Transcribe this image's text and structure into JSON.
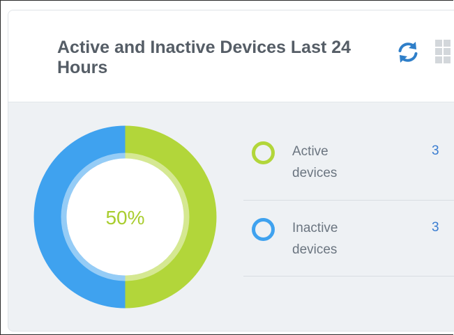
{
  "widget": {
    "title": "Active and Inactive Devices Last 24 Hours",
    "refresh_icon": "refresh-icon",
    "drag_handle_icon": "grid-handle-icon"
  },
  "chart_data": {
    "type": "pie",
    "categories": [
      "Active devices",
      "Inactive devices"
    ],
    "values": [
      3,
      3
    ],
    "center_label": "50%",
    "colors": [
      "#b2d63a",
      "#3fa2ef"
    ]
  },
  "legend": [
    {
      "label": "Active devices",
      "value": "3",
      "color": "#b2d63a"
    },
    {
      "label": "Inactive devices",
      "value": "3",
      "color": "#3fa2ef"
    }
  ],
  "colors": {
    "title": "#555d66",
    "link_value": "#3a7dd1",
    "background": "#eef1f4"
  }
}
